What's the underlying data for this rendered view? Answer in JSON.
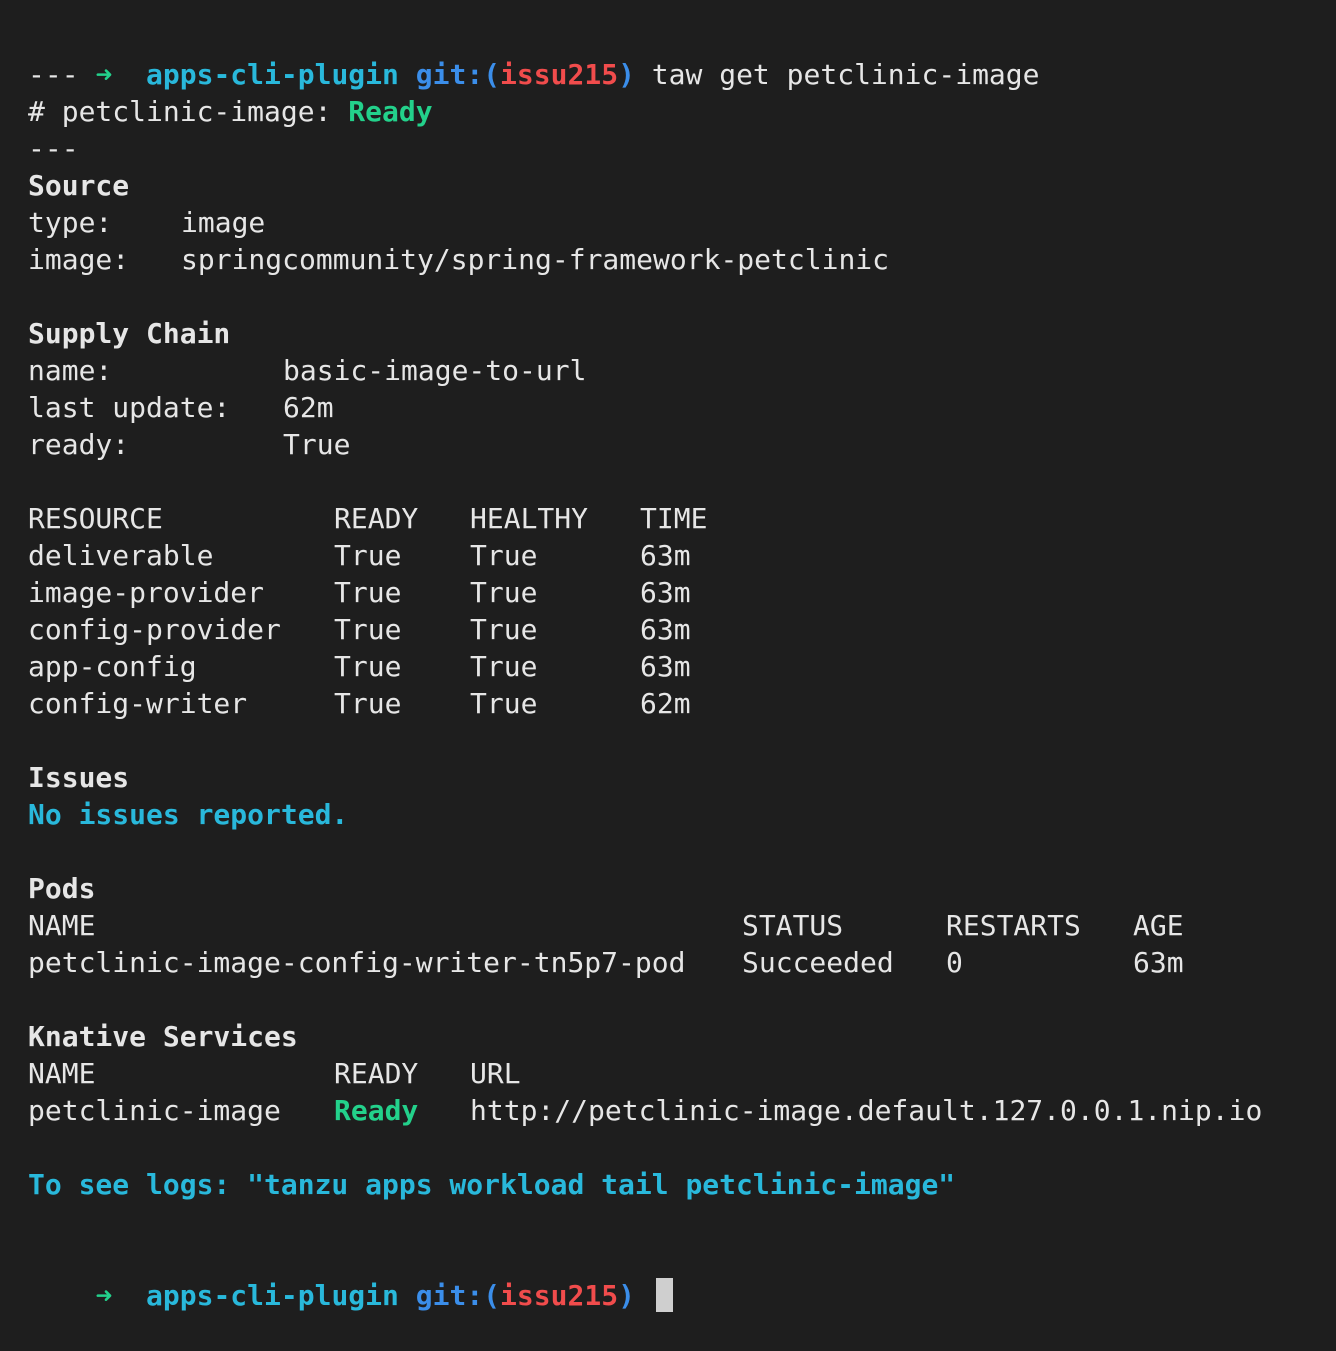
{
  "prompt": {
    "arrow": "➜",
    "dir": "apps-cli-plugin",
    "git_label": "git:",
    "paren_open": "(",
    "branch": "issu215",
    "paren_close": ")"
  },
  "command": "taw get petclinic-image",
  "separator": "---",
  "header": {
    "prefix": "# petclinic-image:",
    "status": "Ready"
  },
  "source": {
    "title": "Source",
    "rows": [
      {
        "key": "type:",
        "value": "image"
      },
      {
        "key": "image:",
        "value": "springcommunity/spring-framework-petclinic"
      }
    ]
  },
  "supply_chain": {
    "title": "Supply Chain",
    "rows": [
      {
        "key": "name:",
        "value": "basic-image-to-url"
      },
      {
        "key": "last update:",
        "value": "62m"
      },
      {
        "key": "ready:",
        "value": "True"
      }
    ]
  },
  "resources": {
    "headers": [
      "RESOURCE",
      "READY",
      "HEALTHY",
      "TIME"
    ],
    "rows": [
      [
        "deliverable",
        "True",
        "True",
        "63m"
      ],
      [
        "image-provider",
        "True",
        "True",
        "63m"
      ],
      [
        "config-provider",
        "True",
        "True",
        "63m"
      ],
      [
        "app-config",
        "True",
        "True",
        "63m"
      ],
      [
        "config-writer",
        "True",
        "True",
        "62m"
      ]
    ]
  },
  "issues": {
    "title": "Issues",
    "message": "No issues reported."
  },
  "pods": {
    "title": "Pods",
    "headers": [
      "NAME",
      "STATUS",
      "RESTARTS",
      "AGE"
    ],
    "rows": [
      [
        "petclinic-image-config-writer-tn5p7-pod",
        "Succeeded",
        "0",
        "63m"
      ]
    ]
  },
  "knative": {
    "title": "Knative Services",
    "headers": [
      "NAME",
      "READY",
      "URL"
    ],
    "rows": [
      [
        "petclinic-image",
        "Ready",
        "http://petclinic-image.default.127.0.0.1.nip.io"
      ]
    ]
  },
  "logs_hint": "To see logs: \"tanzu apps workload tail petclinic-image\"",
  "colors": {
    "background": "#1e1e1e",
    "green": "#23d18b",
    "cyan": "#29b8db",
    "blue": "#3b8eea",
    "red": "#f14c4c",
    "text": "#e6e6e6"
  }
}
